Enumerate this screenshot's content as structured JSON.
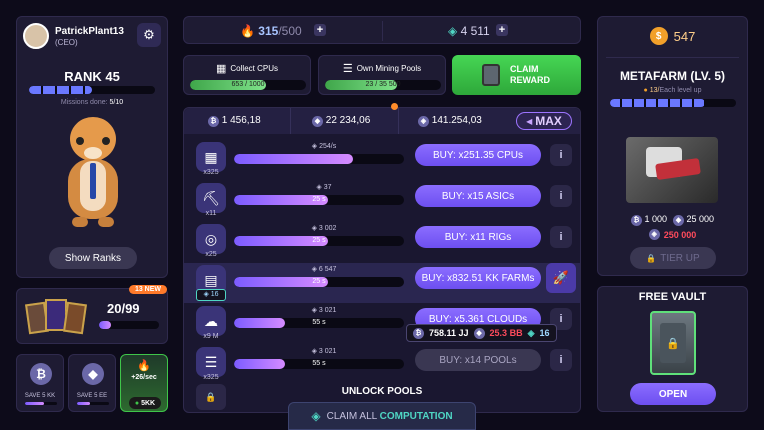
{
  "profile": {
    "name": "PatrickPlant13",
    "role": "(CEO)",
    "rank": "RANK 45",
    "missions_label": "Missions done:",
    "missions_value": "5/10",
    "missions_progress": 0.5,
    "show_ranks": "Show Ranks"
  },
  "cards": {
    "badge": "13 NEW",
    "count": "20/99",
    "progress": 0.2
  },
  "saves": [
    {
      "label": "SAVE 5 KK",
      "icon": "bitcoin-icon"
    },
    {
      "label": "SAVE 5 EE",
      "icon": "ethereum-icon"
    }
  ],
  "boost": {
    "rate": "+26/sec",
    "value": "5KK"
  },
  "top": {
    "energy": "315",
    "energy_max": "/500",
    "gems": "4 511"
  },
  "collect": {
    "label": "Collect CPUs",
    "value": "653 / 1000",
    "progress": 0.653
  },
  "pools": {
    "label": "Own Mining Pools",
    "value": "23 / 35 500",
    "progress": 0.62
  },
  "claim": {
    "label": "CLAIM REWARD"
  },
  "balances": [
    {
      "icon": "bitcoin-icon",
      "value": "1 456,18"
    },
    {
      "icon": "ethereum-icon",
      "value": "22 234,06"
    },
    {
      "icon": "gem-icon",
      "value": "141.254,03"
    }
  ],
  "max_label": "MAX",
  "buildings": [
    {
      "name": "cpu",
      "count": "x325",
      "rate": "254/s",
      "progress": 0.7,
      "bar_text": "",
      "buy": "BUY: x251.35 CPUs",
      "dim": false
    },
    {
      "name": "asic",
      "count": "x11",
      "rate": "37",
      "progress": 0.55,
      "bar_text": "25 s",
      "buy": "BUY: x15 ASICs",
      "dim": false
    },
    {
      "name": "rig",
      "count": "x25",
      "rate": "3 002",
      "progress": 0.55,
      "bar_text": "25 s",
      "buy": "BUY: x11 RIGs",
      "dim": false
    },
    {
      "name": "farm",
      "count": "16",
      "rate": "6 547",
      "progress": 0.55,
      "bar_text": "25 s",
      "buy": "BUY: x832.51 KK FARMs",
      "dim": false
    },
    {
      "name": "cloud",
      "count": "x9 M",
      "rate": "3 021",
      "progress": 0.3,
      "bar_text": "55 s",
      "buy": "BUY: x5.361 CLOUDs",
      "dim": false
    },
    {
      "name": "pool",
      "count": "x325",
      "rate": "3 021",
      "progress": 0.3,
      "bar_text": "55 s",
      "buy": "BUY: x14 POOLs",
      "dim": true
    }
  ],
  "tooltip": {
    "a": "758.11 JJ",
    "b": "25.3 BB",
    "c": "16"
  },
  "unlock_pools": "UNLOCK POOLS",
  "claim_all": {
    "prefix": "CLAIM ALL ",
    "highlight": "COMPUTATION"
  },
  "metafarm": {
    "coins": "547",
    "title": "METAFARM (LV. 5)",
    "level_text": "13/",
    "level_sub": "Each level up",
    "progress": 0.75,
    "cost_btc": "1 000",
    "cost_eth": "25 000",
    "cost_gem": "250 000",
    "tier_up": "TIER UP"
  },
  "vault": {
    "title": "FREE VAULT",
    "open": "OPEN"
  },
  "colors": {
    "accent": "#7c5cff",
    "green": "#3fc54a",
    "red": "#ff4b5c"
  }
}
